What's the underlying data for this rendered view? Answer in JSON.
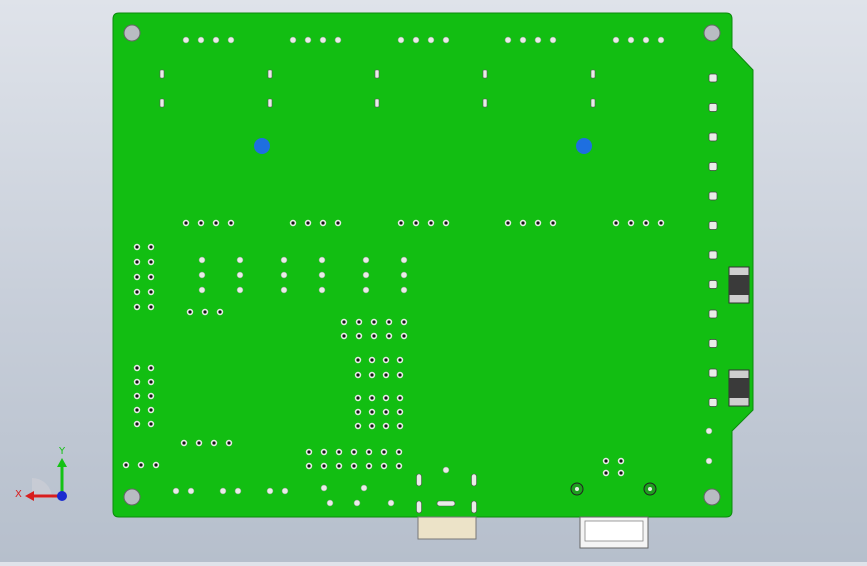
{
  "viewport": {
    "background_top": "#dfe3ea",
    "background_bottom": "#b6bfcc"
  },
  "pcb": {
    "board_color": "#12be12",
    "board_edge_color": "#0c8a0c",
    "mounting_hole_color": "#b8bcc2",
    "pad_color": "#e9ece8",
    "via_color": "#161616",
    "blue_pad_color": "#1e6fe0",
    "cap_body_color": "#3a3a3a",
    "connector_color": "#ece3c8",
    "socket_color": "#f4f4f4"
  },
  "triad": {
    "x_label": "X",
    "y_label": "Y",
    "x_color": "#d81e1e",
    "y_color": "#14c214",
    "z_color": "#1a2ad0"
  }
}
